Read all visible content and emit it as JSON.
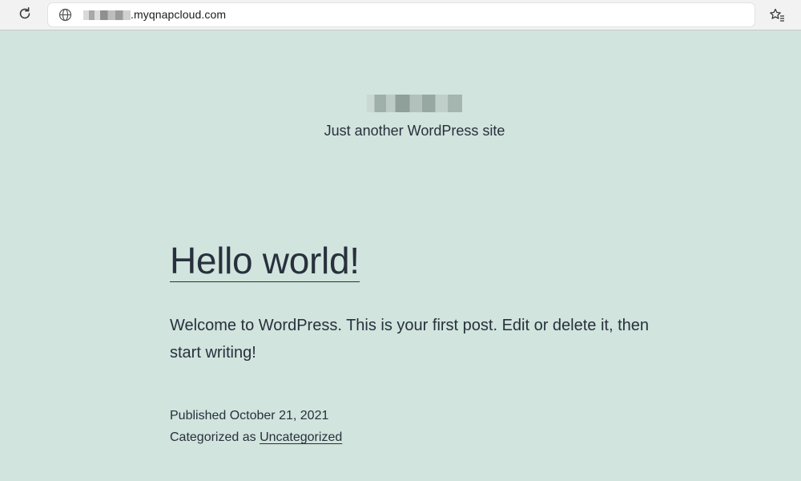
{
  "browser": {
    "url_suffix": ".myqnapcloud.com",
    "icons": [
      "reload-icon",
      "globe-icon",
      "bookmark-star-icon"
    ]
  },
  "site": {
    "description": "Just another WordPress site"
  },
  "post": {
    "title": "Hello world!",
    "body": "Welcome to WordPress. This is your first post. Edit or delete it, then start writing!",
    "published": "Published October 21, 2021",
    "categorized_prefix": "Categorized as ",
    "category": "Uncategorized"
  },
  "colors": {
    "background": "#d1e4dd",
    "text": "#28303d"
  }
}
